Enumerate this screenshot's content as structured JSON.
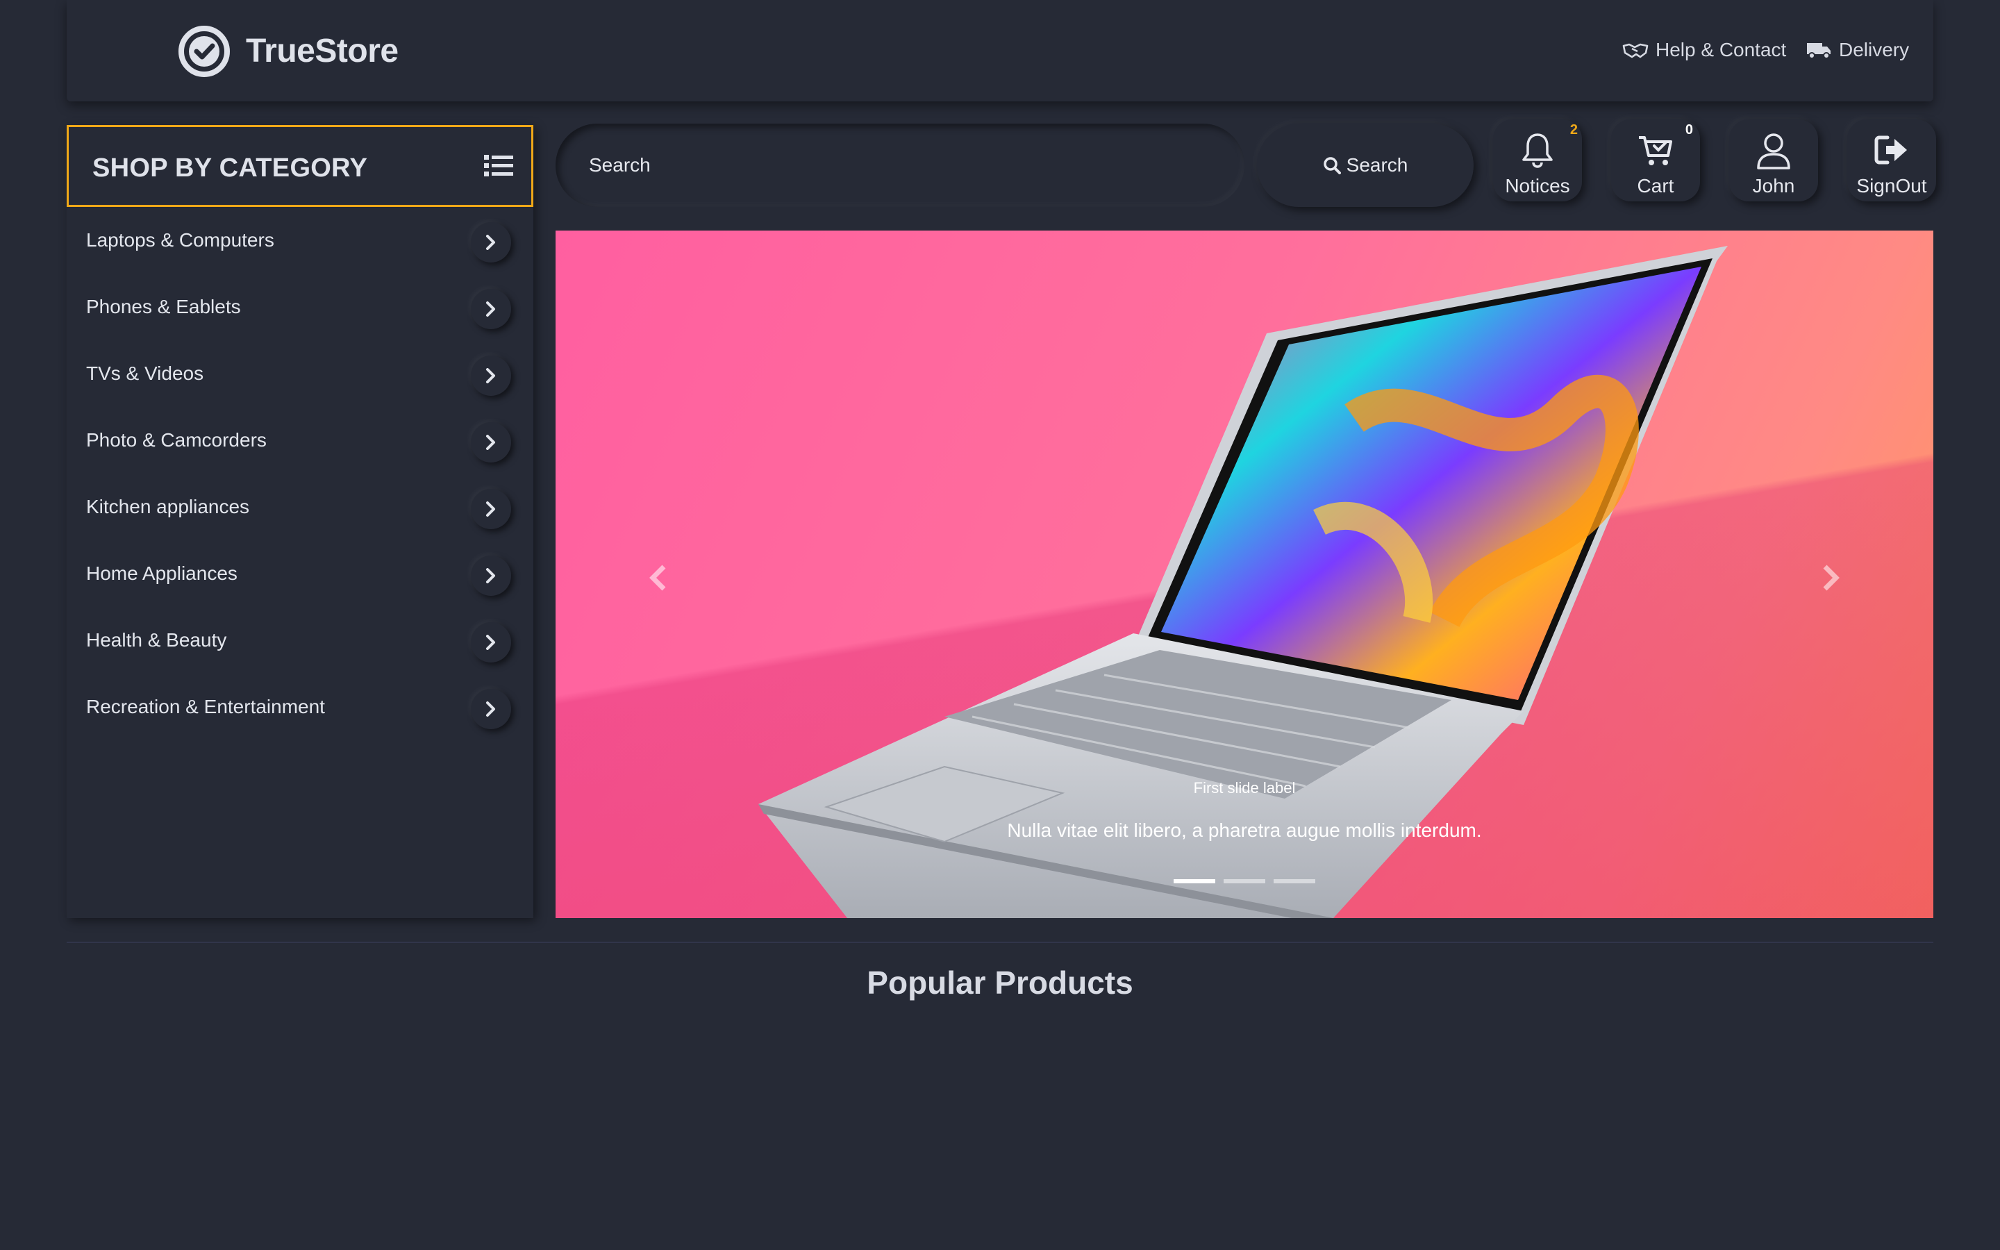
{
  "header": {
    "brand": "TrueStore",
    "links": [
      {
        "label": "Help & Contact",
        "icon": "handshake-icon"
      },
      {
        "label": "Delivery",
        "icon": "truck-icon"
      }
    ]
  },
  "sidebar": {
    "title": "SHOP BY CATEGORY",
    "items": [
      {
        "label": "Laptops & Computers"
      },
      {
        "label": "Phones & Eablets"
      },
      {
        "label": "TVs & Videos"
      },
      {
        "label": "Photo & Camcorders"
      },
      {
        "label": "Kitchen appliances"
      },
      {
        "label": "Home Appliances"
      },
      {
        "label": "Health & Beauty"
      },
      {
        "label": "Recreation & Entertainment"
      }
    ]
  },
  "search": {
    "placeholder": "Search",
    "button_label": "Search"
  },
  "toolbar": {
    "notices": {
      "label": "Notices",
      "badge": "2",
      "badge_color": "#f0a818"
    },
    "cart": {
      "label": "Cart",
      "badge": "0",
      "badge_color": "#ffffff"
    },
    "user": {
      "label": "John"
    },
    "signout": {
      "label": "SignOut"
    }
  },
  "carousel": {
    "caption_title": "First slide label",
    "caption_text": "Nulla vitae elit libero, a pharetra augue mollis interdum.",
    "slide_count": 3,
    "active_slide": 1
  },
  "main": {
    "section_title": "Popular Products"
  },
  "colors": {
    "background": "#262a36",
    "accent": "#f0a818",
    "text": "#e6e8ee"
  }
}
